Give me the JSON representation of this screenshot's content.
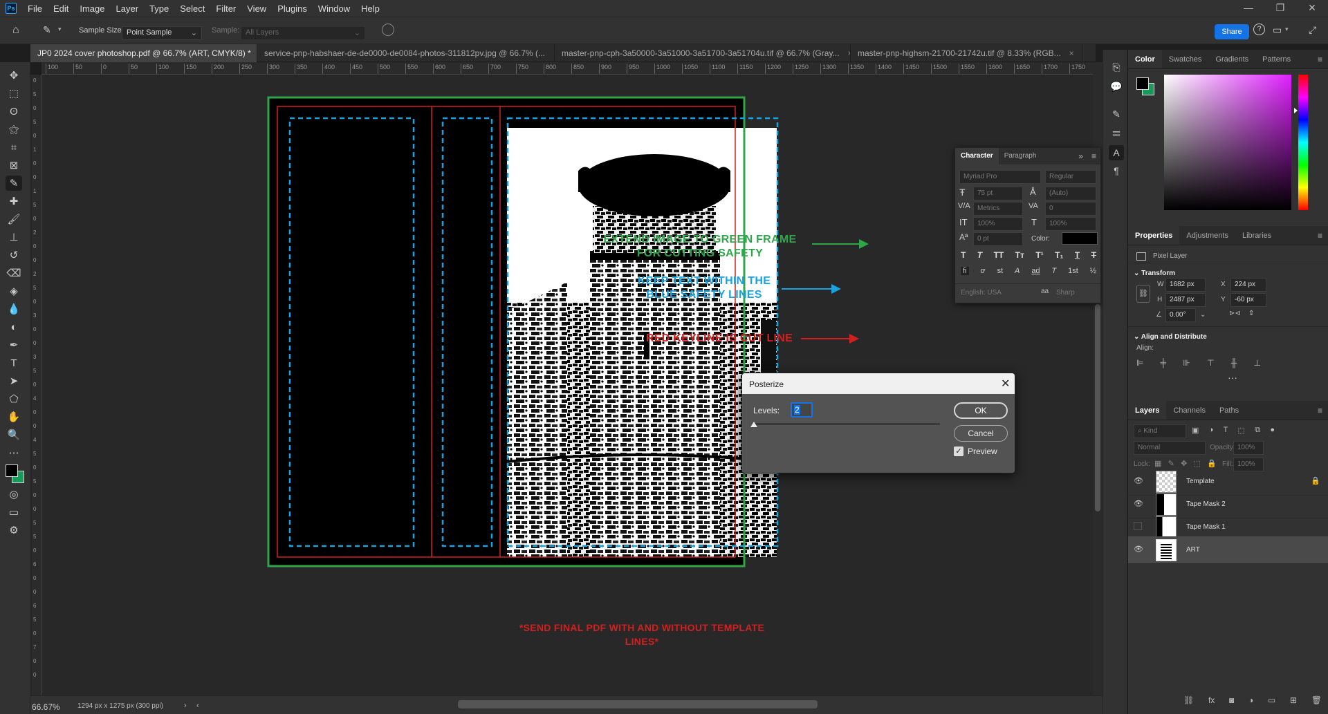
{
  "menubar": {
    "logo": "Ps",
    "items": [
      "File",
      "Edit",
      "Image",
      "Layer",
      "Type",
      "Select",
      "Filter",
      "View",
      "Plugins",
      "Window",
      "Help"
    ],
    "window_controls": [
      "—",
      "❐",
      "✕"
    ]
  },
  "options": {
    "sample_size_label": "Sample Size:",
    "sample_size_value": "Point Sample",
    "sample_label": "Sample:",
    "sample_value": "All Layers",
    "share": "Share"
  },
  "tabs": [
    {
      "label": "JP0 2024 cover photoshop.pdf @ 66.7% (ART, CMYK/8) *",
      "active": true
    },
    {
      "label": "service-pnp-habshaer-de-de0000-de0084-photos-311812pv.jpg @ 66.7% (...",
      "active": false
    },
    {
      "label": "master-pnp-cph-3a50000-3a51000-3a51700-3a51704u.tif @ 66.7% (Gray...",
      "active": false
    },
    {
      "label": "master-pnp-highsm-21700-21742u.tif @ 8.33% (RGB...",
      "active": false
    }
  ],
  "ruler_h": [
    "100",
    "50",
    "0",
    "50",
    "100",
    "150",
    "200",
    "250",
    "300",
    "350",
    "400",
    "450",
    "500",
    "550",
    "600",
    "650",
    "700",
    "750",
    "800",
    "850",
    "900",
    "950",
    "1000",
    "1050",
    "1100",
    "1150",
    "1200",
    "1250",
    "1300",
    "1350",
    "1400",
    "1450",
    "1500",
    "1550",
    "1600",
    "1650",
    "1700",
    "1750"
  ],
  "ruler_v": [
    "0",
    "5",
    "0",
    "5",
    "0",
    "1",
    "0",
    "0",
    "1",
    "5",
    "0",
    "2",
    "0",
    "0",
    "2",
    "5",
    "0",
    "3",
    "0",
    "0",
    "3",
    "5",
    "0",
    "4",
    "0",
    "0",
    "4",
    "5",
    "0",
    "5",
    "0",
    "0",
    "5",
    "5",
    "0",
    "6",
    "0",
    "0",
    "6",
    "5",
    "0",
    "7",
    "0",
    "0"
  ],
  "annotations": {
    "green1": "EXTEND IMAGE TO GREEN FRAME",
    "green2": "FOR CUTTING SAFETY",
    "blue1": "KEEP TEXT WITHIN THE",
    "blue2": "BLUE SAFETY LINES",
    "red": "RED KEYLINE IS CUT LINE",
    "bottom": "*SEND FINAL PDF WITH AND WITHOUT TEMPLATE LINES*"
  },
  "colors": {
    "green": "#2fa64a",
    "blue": "#19a3e0",
    "red": "#d22020",
    "accent": "#1473e6"
  },
  "status": {
    "zoom": "66.67%",
    "doc_info": "1294 px x 1275 px (300 ppi)"
  },
  "character": {
    "tabs": [
      "Character",
      "Paragraph"
    ],
    "font": "Myriad Pro",
    "style": "Regular",
    "size": "75 pt",
    "leading": "(Auto)",
    "kerning": "Metrics",
    "tracking": "0",
    "vscale": "100%",
    "hscale": "100%",
    "baseline": "0 pt",
    "color_label": "Color:",
    "language": "English: USA",
    "aa": "aa",
    "aa_value": "Sharp",
    "style_buttons": [
      "T",
      "T",
      "TT",
      "Tт",
      "T¹",
      "T₁",
      "T",
      "T"
    ],
    "ot_buttons": [
      "fi",
      "ơ",
      "st",
      "A",
      "ad",
      "T",
      "1st",
      "½"
    ]
  },
  "posterize": {
    "title": "Posterize",
    "levels_label": "Levels:",
    "levels_value": "2",
    "ok": "OK",
    "cancel": "Cancel",
    "preview": "Preview",
    "preview_checked": true
  },
  "color_panel": {
    "tabs": [
      "Color",
      "Swatches",
      "Gradients",
      "Patterns"
    ]
  },
  "properties": {
    "tabs": [
      "Properties",
      "Adjustments",
      "Libraries"
    ],
    "type": "Pixel Layer",
    "transform": "Transform",
    "w_label": "W",
    "w": "1682 px",
    "h_label": "H",
    "h": "2487 px",
    "x_label": "X",
    "x": "224 px",
    "y_label": "Y",
    "y": "-60 px",
    "angle": "0.00°",
    "align_title": "Align and Distribute",
    "align_label": "Align:"
  },
  "layers": {
    "tabs": [
      "Layers",
      "Channels",
      "Paths"
    ],
    "kind": "Kind",
    "blend": "Normal",
    "opacity_label": "Opacity:",
    "opacity": "100%",
    "lock_label": "Lock:",
    "fill_label": "Fill:",
    "fill": "100%",
    "items": [
      {
        "name": "Template",
        "visible": true,
        "locked": true
      },
      {
        "name": "Tape Mask 2",
        "visible": true,
        "locked": false
      },
      {
        "name": "Tape Mask 1",
        "visible": false,
        "locked": false
      },
      {
        "name": "ART",
        "visible": true,
        "locked": false,
        "selected": true
      }
    ]
  }
}
